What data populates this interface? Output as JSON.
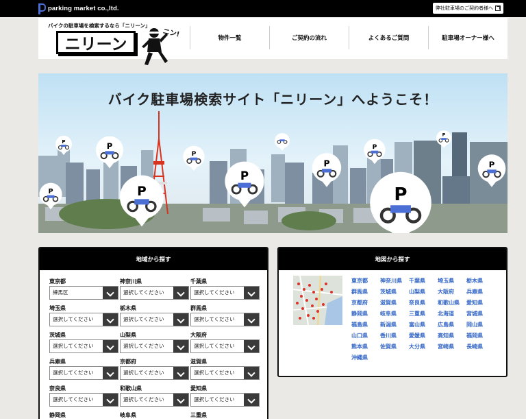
{
  "topbar": {
    "brand": "parking market co.,ltd.",
    "owner_link": "弊社駐車場のご契約者様へ"
  },
  "header": {
    "tagline": "バイクの駐車場を検索するなら「ニリーン」",
    "logo_text": "ニリーン",
    "mascot_speech": "ニン!",
    "nav": [
      "物件一覧",
      "ご契約の流れ",
      "よくあるご質問",
      "駐車場オーナー様へ"
    ]
  },
  "hero": {
    "headline": "バイク駐車場検索サイト「ニリーン」へようこそ！",
    "pin_letter": "P"
  },
  "region_search": {
    "title": "地域から探す",
    "prefectures": [
      {
        "label": "東京都",
        "value": "練馬区"
      },
      {
        "label": "神奈川県",
        "value": "選択してください"
      },
      {
        "label": "千葉県",
        "value": "選択してください"
      },
      {
        "label": "埼玉県",
        "value": "選択してください"
      },
      {
        "label": "栃木県",
        "value": "選択してください"
      },
      {
        "label": "群馬県",
        "value": "選択してください"
      },
      {
        "label": "茨城県",
        "value": "選択してください"
      },
      {
        "label": "山梨県",
        "value": "選択してください"
      },
      {
        "label": "大阪府",
        "value": "選択してください"
      },
      {
        "label": "兵庫県",
        "value": "選択してください"
      },
      {
        "label": "京都府",
        "value": "選択してください"
      },
      {
        "label": "滋賀県",
        "value": "選択してください"
      },
      {
        "label": "奈良県",
        "value": "選択してください"
      },
      {
        "label": "和歌山県",
        "value": "選択してください"
      },
      {
        "label": "愛知県",
        "value": "選択してください"
      },
      {
        "label": "静岡県",
        "value": ""
      },
      {
        "label": "岐阜県",
        "value": ""
      },
      {
        "label": "三重県",
        "value": ""
      }
    ]
  },
  "map_search": {
    "title": "地図から探す",
    "prefectures": [
      "東京都",
      "神奈川県",
      "千葉県",
      "埼玉県",
      "栃木県",
      "群馬県",
      "茨城県",
      "山梨県",
      "大阪府",
      "兵庫県",
      "京都府",
      "滋賀県",
      "奈良県",
      "和歌山県",
      "愛知県",
      "静岡県",
      "岐阜県",
      "三重県",
      "北海道",
      "宮城県",
      "福島県",
      "新潟県",
      "富山県",
      "広島県",
      "岡山県",
      "山口県",
      "香川県",
      "愛媛県",
      "高知県",
      "福岡県",
      "熊本県",
      "佐賀県",
      "大分県",
      "宮崎県",
      "長崎県",
      "沖縄県"
    ]
  },
  "colors": {
    "link": "#3164c4",
    "pin_blue": "#4c6fd6",
    "bar": "#000000"
  }
}
